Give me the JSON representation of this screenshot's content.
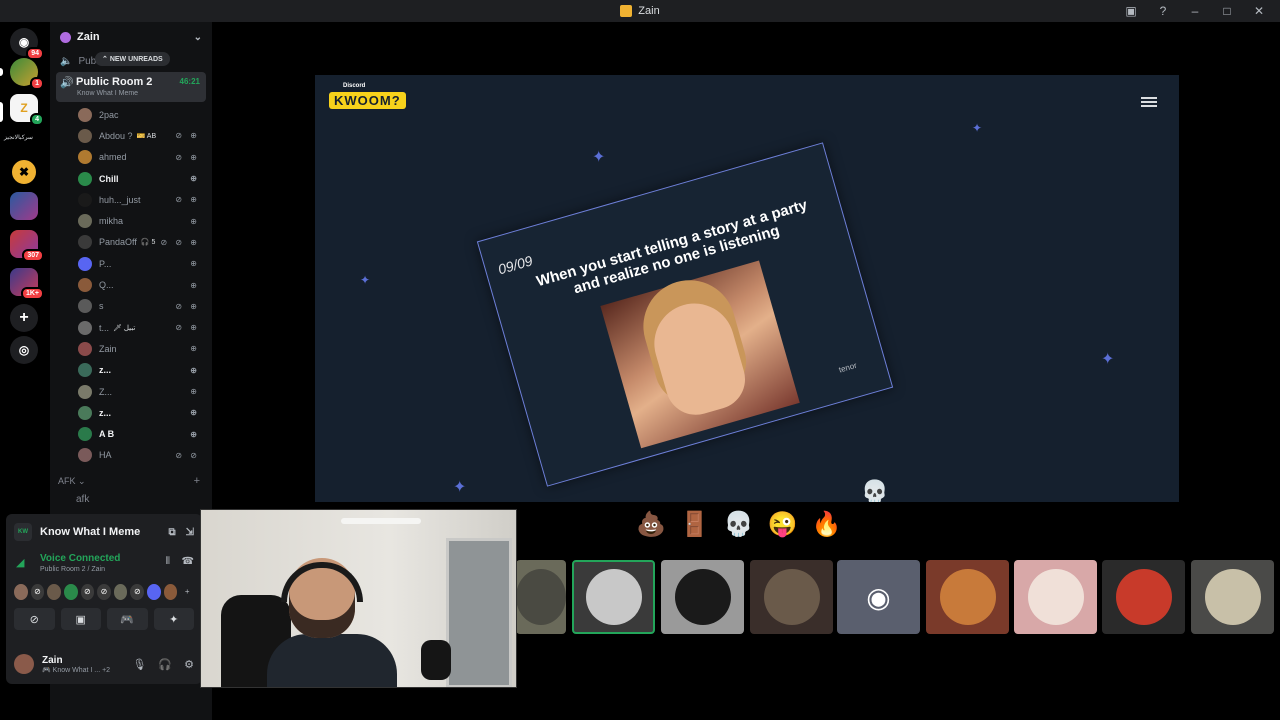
{
  "window": {
    "title": "Zain"
  },
  "server": {
    "name": "Zain"
  },
  "rail": {
    "badges": {
      "home": "94",
      "srv1": "1",
      "srv2": "4",
      "srv_text": "سركبالانجيز",
      "srv_group1": "307",
      "srv_group2": "1K+"
    }
  },
  "channels": {
    "public_partial": "Publ",
    "new_unreads": "NEW UNREADS",
    "active": {
      "name": "Public Room 2",
      "activity": "Know What I Meme",
      "time": "46:21"
    },
    "afk_category": "AFK",
    "afk_channel": "afk"
  },
  "members": [
    {
      "name": "2pac",
      "icons": "",
      "bright": false,
      "color": "#8a6a5a"
    },
    {
      "name": "Abdou ?",
      "icons": "⊘ ⊕",
      "extra": "🎫 AB",
      "bright": false,
      "color": "#6a5a4a"
    },
    {
      "name": "ahmed",
      "icons": "⊘ ⊕",
      "bright": false,
      "color": "#b07a30"
    },
    {
      "name": "Chill",
      "icons": "⊕",
      "bright": true,
      "color": "#2a8a4a"
    },
    {
      "name": "huh..._just",
      "icons": "⊘ ⊕",
      "bright": false,
      "color": "#1a1a1a"
    },
    {
      "name": "mikha",
      "icons": "⊕",
      "bright": false,
      "color": "#6a6a5a"
    },
    {
      "name": "PandaOff",
      "icons": "⊘ ⊘ ⊕",
      "extra": "🎧 5",
      "bright": false,
      "color": "#3a3a3a"
    },
    {
      "name": "P...",
      "icons": "⊕",
      "bright": false,
      "color": "#5865f2"
    },
    {
      "name": "Q...",
      "icons": "⊕",
      "bright": false,
      "color": "#8a5a3a"
    },
    {
      "name": "s",
      "icons": "⊘ ⊕",
      "bright": false,
      "color": "#5a5a5a"
    },
    {
      "name": "t...",
      "icons": "⊘ ⊕",
      "extra": "🗡 تبيل",
      "bright": false,
      "color": "#6a6a6a"
    },
    {
      "name": "Zain",
      "icons": "⊕",
      "bright": false,
      "color": "#8a4a4a"
    },
    {
      "name": "z...",
      "icons": "⊕",
      "bright": true,
      "color": "#3a6a5a"
    },
    {
      "name": "Z...",
      "icons": "⊕",
      "bright": false,
      "color": "#7a7a6a"
    },
    {
      "name": "z...",
      "icons": "⊕",
      "bright": true,
      "color": "#4a7a5a"
    },
    {
      "name": "A B",
      "icons": "⊕",
      "bright": true,
      "color": "#2a7a4a"
    },
    {
      "name": "HA",
      "icons": "⊘ ⊘",
      "bright": false,
      "color": "#7a5a5a"
    }
  ],
  "voice_panel": {
    "activity_title": "Know What I Meme",
    "status": "Voice Connected",
    "location": "Public Room 2 / Zain"
  },
  "user": {
    "name": "Zain",
    "status": "Know What I ...",
    "extra": "+2"
  },
  "game": {
    "brand_small": "Discord",
    "brand_logo": "KWOOM?",
    "counter": "09/09",
    "caption": "When you start telling a story at a party and realize no one is listening",
    "gif_source": "tenor"
  },
  "reactions": [
    "💩",
    "🚪",
    "💀",
    "😜",
    "🔥"
  ],
  "colors": {
    "accent_green": "#23a55a",
    "blurple": "#5865f2",
    "brand_yellow": "#f7d21b",
    "activity_bg": "#15202e"
  }
}
